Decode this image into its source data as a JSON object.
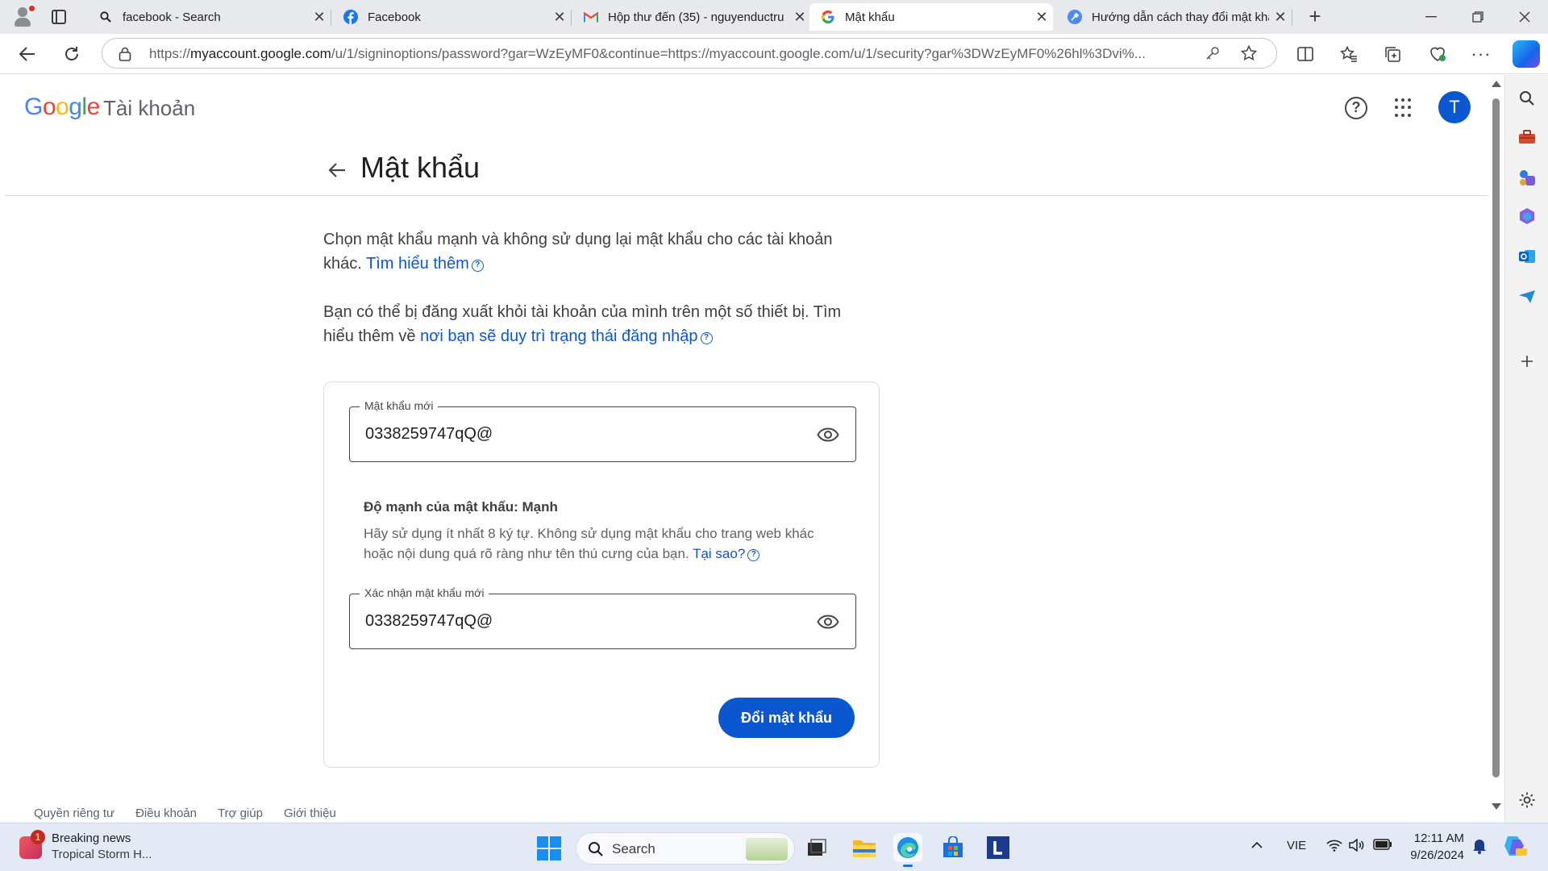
{
  "browser": {
    "tabs": [
      {
        "title": "facebook - Search",
        "icon": "search-icon",
        "active": false
      },
      {
        "title": "Facebook",
        "icon": "facebook-icon",
        "active": false
      },
      {
        "title": "Hộp thư đến (35) - nguyenductru",
        "icon": "gmail-icon",
        "active": false
      },
      {
        "title": "Mật khẩu",
        "icon": "google-icon",
        "active": true
      },
      {
        "title": "Hướng dẫn cách thay đổi mật khẩ",
        "icon": "tool-icon",
        "active": false
      }
    ],
    "url_prefix": "https://",
    "url_domain": "myaccount.google.com",
    "url_rest": "/u/1/signinoptions/password?gar=WzEyMF0&continue=https://myaccount.google.com/u/1/security?gar%3DWzEyMF0%26hl%3Dvi%..."
  },
  "header": {
    "logo_letters": [
      "G",
      "o",
      "o",
      "g",
      "l",
      "e"
    ],
    "product": "Tài khoản",
    "avatar_initial": "T"
  },
  "page": {
    "title": "Mật khẩu",
    "para1_text": "Chọn mật khẩu mạnh và không sử dụng lại mật khẩu cho các tài khoản khác. ",
    "para1_link": "Tìm hiểu thêm",
    "para2_text": "Bạn có thể bị đăng xuất khỏi tài khoản của mình trên một số thiết bị. Tìm hiểu thêm về ",
    "para2_link": "nơi bạn sẽ duy trì trạng thái đăng nhập",
    "help_glyph": "?"
  },
  "form": {
    "new_password_label": "Mật khẩu mới",
    "new_password_value": "0338259747qQ@",
    "strength_title": "Độ mạnh của mật khẩu: Mạnh",
    "strength_desc": "Hãy sử dụng ít nhất 8 ký tự. Không sử dụng mật khẩu cho trang web khác hoặc nội dung quá rõ ràng như tên thú cưng của bạn. ",
    "strength_link": "Tại sao?",
    "confirm_label": "Xác nhận mật khẩu mới",
    "confirm_value": "0338259747qQ@",
    "submit_label": "Đổi mật khẩu"
  },
  "footer": {
    "links": [
      "Quyền riêng tư",
      "Điều khoản",
      "Trợ giúp",
      "Giới thiệu"
    ]
  },
  "taskbar": {
    "news_count": "1",
    "news_title": "Breaking news",
    "news_sub": "Tropical Storm H...",
    "search_label": "Search",
    "language": "VIE",
    "time": "12:11 AM",
    "date": "9/26/2024"
  },
  "colors": {
    "accent": "#0b57d0",
    "avatar": "#0b57d0",
    "taskbar": "#e3eaf5"
  }
}
